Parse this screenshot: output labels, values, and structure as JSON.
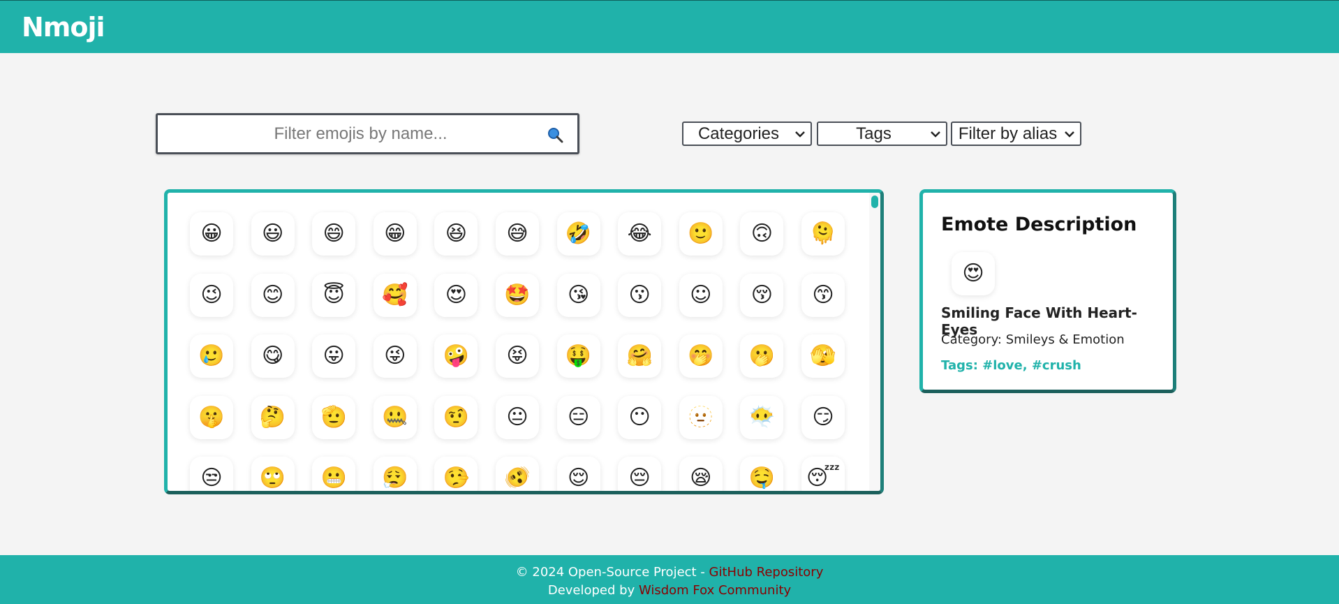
{
  "header": {
    "brand": "Nmoji"
  },
  "search": {
    "placeholder": "Filter emojis by name...",
    "icon": "magnifier-icon"
  },
  "filters": {
    "categories": "Categories",
    "tags": "Tags",
    "alias": "Filter by alias"
  },
  "grid": {
    "rows": [
      [
        "😀",
        "😃",
        "😄",
        "😁",
        "😆",
        "😅",
        "🤣",
        "😂",
        "🙂",
        "🙃",
        "🫠"
      ],
      [
        "😉",
        "😊",
        "😇",
        "🥰",
        "😍",
        "🤩",
        "😘",
        "😗",
        "☺",
        "😚",
        "😙"
      ],
      [
        "🥲",
        "😋",
        "😛",
        "😜",
        "🤪",
        "😝",
        "🤑",
        "🤗",
        "🤭",
        "🫢",
        "🫣"
      ],
      [
        "🤫",
        "🤔",
        "🫡",
        "🤐",
        "🤨",
        "😐",
        "😑",
        "😶",
        "🫥",
        "😶‍🌫️",
        "😏"
      ],
      [
        "😒",
        "🙄",
        "😬",
        "😮‍💨",
        "🤥",
        "🫨",
        "😌",
        "😔",
        "😪",
        "🤤",
        "😴"
      ]
    ]
  },
  "description": {
    "title": "Emote Description",
    "emoji": "😍",
    "name": "Smiling Face With Heart-Eyes",
    "category": "Category: Smileys & Emotion",
    "tags": "Tags: #love, #crush"
  },
  "footer": {
    "line1_prefix": "© 2024 Open-Source Project - ",
    "line1_link": "GitHub Repository",
    "line2_prefix": "Developed by ",
    "line2_link": "Wisdom Fox Community"
  },
  "colors": {
    "accent": "#20b2aa",
    "accent_dark": "#1b5f5b",
    "link": "#8b0000"
  }
}
